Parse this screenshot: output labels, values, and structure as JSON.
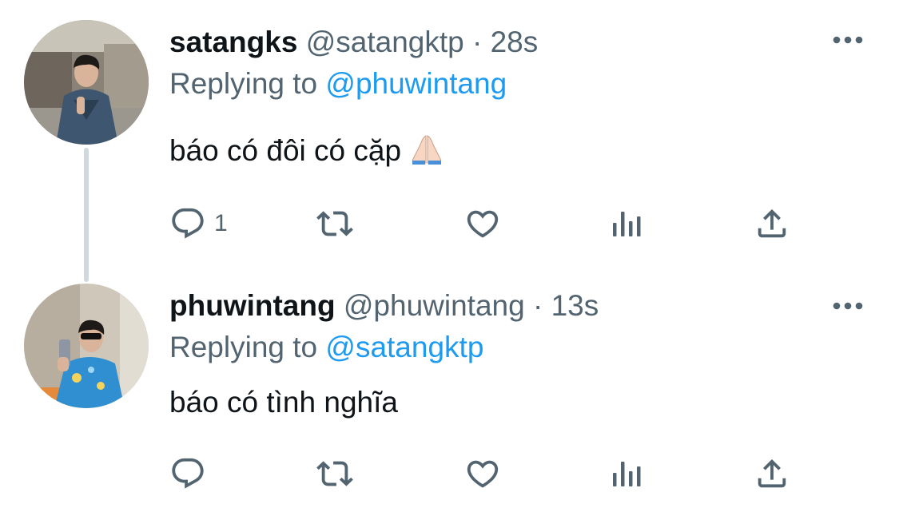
{
  "tweets": [
    {
      "display_name": "satangks",
      "handle": "@satangktp",
      "separator": "·",
      "time": "28s",
      "replying_prefix": "Replying to",
      "replying_to": "@phuwintang",
      "text": "báo có đôi có cặp",
      "emoji": "folded-hands",
      "reply_count": "1",
      "retweet_count": "",
      "like_count": "",
      "views_count": ""
    },
    {
      "display_name": "phuwintang",
      "handle": "@phuwintang",
      "separator": "·",
      "time": "13s",
      "replying_prefix": "Replying to",
      "replying_to": "@satangktp",
      "text": "báo có tình nghĩa",
      "reply_count": "",
      "retweet_count": "",
      "like_count": "",
      "views_count": ""
    }
  ],
  "icons": {
    "reply": "reply-icon",
    "retweet": "retweet-icon",
    "like": "like-icon",
    "views": "views-icon",
    "share": "share-icon",
    "more": "more-options-icon"
  },
  "colors": {
    "text": "#0f1419",
    "secondary": "#536471",
    "link": "#1d9bf0",
    "thread_line": "#cfd9de"
  }
}
